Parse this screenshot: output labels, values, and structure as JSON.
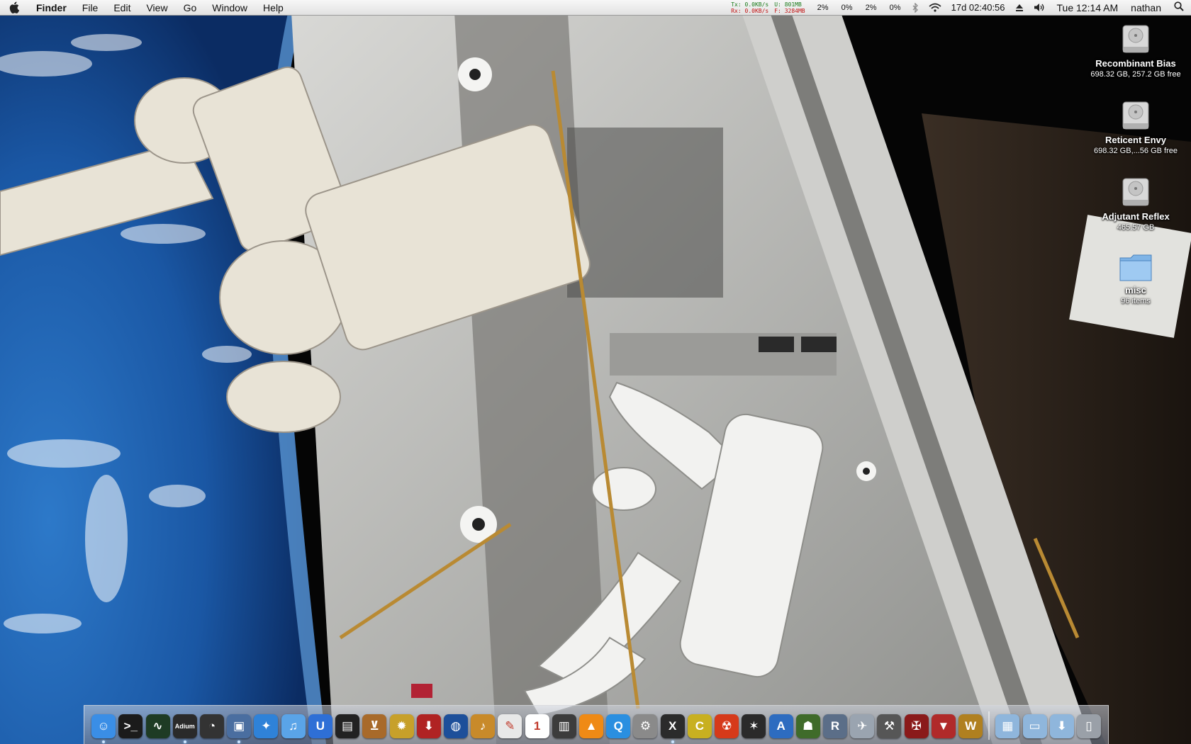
{
  "menubar": {
    "app_name": "Finder",
    "menus": [
      "File",
      "Edit",
      "View",
      "Go",
      "Window",
      "Help"
    ],
    "network": {
      "tx_label": "Tx:",
      "tx_value": "0.0KB/s",
      "rx_label": "Rx:",
      "rx_value": "0.0KB/s"
    },
    "memory": {
      "used_label": "U:",
      "used_value": "801MB",
      "free_label": "F:",
      "free_value": "3284MB"
    },
    "cpu": [
      "2%",
      "0%",
      "2%",
      "0%"
    ],
    "uptime": "17d 02:40:56",
    "clock": "Tue 12:14 AM",
    "user": "nathan",
    "icons": [
      "apple-icon",
      "bluetooth-icon",
      "wifi-icon",
      "eject-icon",
      "volume-icon",
      "spotlight-icon"
    ]
  },
  "desktop_icons": [
    {
      "name": "Recombinant Bias",
      "info": "698.32 GB, 257.2 GB free",
      "kind": "hard-drive-icon"
    },
    {
      "name": "Reticent Envy",
      "info": "698.32 GB,...56 GB free",
      "kind": "hard-drive-icon"
    },
    {
      "name": "Adjutant Reflex",
      "info": "465.57 GB",
      "kind": "hard-drive-icon"
    },
    {
      "name": "misc",
      "info": "96 items",
      "kind": "folder-icon"
    }
  ],
  "dock": {
    "apps": [
      {
        "id": "finder",
        "label": "Finder",
        "icon": "finder-icon",
        "glyph": "☺",
        "color": "#3a8ee6",
        "running": true
      },
      {
        "id": "terminal",
        "label": "Terminal",
        "icon": "terminal-icon",
        "glyph": ">_",
        "color": "#1b1b1b",
        "running": false
      },
      {
        "id": "activity-monitor",
        "label": "Activity Monitor",
        "icon": "activity-monitor-icon",
        "glyph": "∿",
        "color": "#1e3b24",
        "running": false
      },
      {
        "id": "adium",
        "label": "Adium",
        "icon": "adium-icon",
        "glyph": "Adium",
        "color": "#2a2a2a",
        "running": true
      },
      {
        "id": "istat",
        "label": "iStat",
        "icon": "gauge-icon",
        "glyph": "◔",
        "color": "#333333",
        "running": false
      },
      {
        "id": "preview",
        "label": "Preview",
        "icon": "preview-icon",
        "glyph": "▣",
        "color": "#4a6ea0",
        "running": true
      },
      {
        "id": "safari",
        "label": "Safari",
        "icon": "safari-icon",
        "glyph": "✦",
        "color": "#2f82d8",
        "running": false
      },
      {
        "id": "itunes",
        "label": "iTunes",
        "icon": "itunes-icon",
        "glyph": "♫",
        "color": "#5aa4e8",
        "running": false
      },
      {
        "id": "textmate",
        "label": "TextMate",
        "icon": "textmate-icon",
        "glyph": "U",
        "color": "#2e6fd6",
        "running": false
      },
      {
        "id": "final-cut",
        "label": "Final Cut",
        "icon": "clapper-icon",
        "glyph": "▤",
        "color": "#222222",
        "running": false
      },
      {
        "id": "adium-cocktail",
        "label": "Cocktail",
        "icon": "cocktail-icon",
        "glyph": "⊻",
        "color": "#a86a2a",
        "running": false
      },
      {
        "id": "pineapple",
        "label": "Pineapple",
        "icon": "pineapple-icon",
        "glyph": "✹",
        "color": "#c7a02a",
        "running": false
      },
      {
        "id": "transmission",
        "label": "Transmission",
        "icon": "transmission-icon",
        "glyph": "⬇",
        "color": "#b02323",
        "running": false
      },
      {
        "id": "google-earth",
        "label": "Google Earth",
        "icon": "google-earth-icon",
        "glyph": "◍",
        "color": "#1d4f9a",
        "running": false
      },
      {
        "id": "garageband",
        "label": "GarageBand",
        "icon": "guitar-icon",
        "glyph": "♪",
        "color": "#c88a2a",
        "running": false
      },
      {
        "id": "textedit",
        "label": "TextEdit",
        "icon": "textedit-icon",
        "glyph": "✎",
        "color": "#e8e8e8",
        "running": false
      },
      {
        "id": "ical",
        "label": "iCal",
        "icon": "calendar-icon",
        "glyph": "1",
        "color": "#ffffff",
        "running": false
      },
      {
        "id": "film",
        "label": "Film",
        "icon": "film-icon",
        "glyph": "▥",
        "color": "#3c3c3c",
        "running": false
      },
      {
        "id": "vlc",
        "label": "VLC",
        "icon": "vlc-icon",
        "glyph": "▲",
        "color": "#ef8a15",
        "running": false
      },
      {
        "id": "quicktime",
        "label": "QuickTime",
        "icon": "quicktime-icon",
        "glyph": "Q",
        "color": "#2a8fe0",
        "running": false
      },
      {
        "id": "system-prefs",
        "label": "System Preferences",
        "icon": "gear-icon",
        "glyph": "⚙",
        "color": "#8a8a8a",
        "running": false
      },
      {
        "id": "x11",
        "label": "X11",
        "icon": "x11-icon",
        "glyph": "X",
        "color": "#2b2b2b",
        "running": true
      },
      {
        "id": "cyberduck",
        "label": "Cyberduck",
        "icon": "cyberduck-icon",
        "glyph": "C",
        "color": "#c8b020",
        "running": false
      },
      {
        "id": "radiation",
        "label": "Disk Utility",
        "icon": "radiation-icon",
        "glyph": "☢",
        "color": "#d63a1a",
        "running": false
      },
      {
        "id": "nova",
        "label": "Nova",
        "icon": "nova-icon",
        "glyph": "✶",
        "color": "#2a2a2a",
        "running": false
      },
      {
        "id": "app-store",
        "label": "App",
        "icon": "compass-icon",
        "glyph": "A",
        "color": "#2d6cc0",
        "running": false
      },
      {
        "id": "halo",
        "label": "Halo",
        "icon": "halo-icon",
        "glyph": "☗",
        "color": "#3f6b2a",
        "running": false
      },
      {
        "id": "rbrowser",
        "label": "RBrowser",
        "icon": "rbrowser-icon",
        "glyph": "R",
        "color": "#5b6e88",
        "running": false
      },
      {
        "id": "mail",
        "label": "Mail",
        "icon": "mail-icon",
        "glyph": "✈",
        "color": "#9aa4b0",
        "running": false
      },
      {
        "id": "tools",
        "label": "Tools",
        "icon": "tools-icon",
        "glyph": "⚒",
        "color": "#565656",
        "running": false
      },
      {
        "id": "starcraft",
        "label": "StarCraft",
        "icon": "starcraft-icon",
        "glyph": "✠",
        "color": "#8a1a1a",
        "running": false
      },
      {
        "id": "warcraft-emblem",
        "label": "Warcraft III",
        "icon": "shield-emblem-icon",
        "glyph": "▼",
        "color": "#b02a2a",
        "running": false
      },
      {
        "id": "wow",
        "label": "World of Warcraft",
        "icon": "wow-icon",
        "glyph": "W",
        "color": "#b08020",
        "running": false
      }
    ],
    "stacks": [
      {
        "id": "applications",
        "label": "Applications",
        "icon": "applications-folder-icon",
        "glyph": "▦",
        "color": "#8fb6dc"
      },
      {
        "id": "documents",
        "label": "Documents",
        "icon": "documents-folder-icon",
        "glyph": "▭",
        "color": "#8fb6dc"
      },
      {
        "id": "downloads",
        "label": "Downloads",
        "icon": "downloads-folder-icon",
        "glyph": "⬇",
        "color": "#8fb6dc"
      },
      {
        "id": "trash",
        "label": "Trash",
        "icon": "trash-icon",
        "glyph": "▯",
        "color": "#9aa0a8"
      }
    ]
  }
}
